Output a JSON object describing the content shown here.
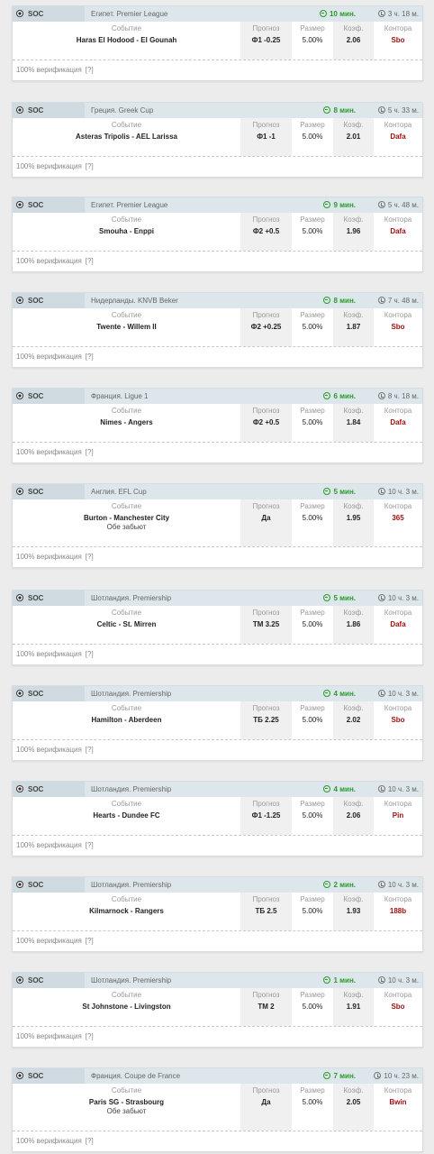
{
  "labels": {
    "sport": "SOC",
    "event": "Событие",
    "prediction": "Прогноз",
    "size": "Размер",
    "odds": "Коэф.",
    "bookmaker": "Контора",
    "verify": "100% верификация",
    "help": "[?]"
  },
  "tips": [
    {
      "league": "Египет. Premier League",
      "ago": "10 мин.",
      "left": "3 ч. 18 м.",
      "event": "Haras El Hodood - El Gounah",
      "sub": "",
      "prediction": "Ф1 -0.25",
      "size": "5.00%",
      "odds": "2.06",
      "bookmaker": "Sbo"
    },
    {
      "league": "Греция. Greek Cup",
      "ago": "8 мин.",
      "left": "5 ч. 33 м.",
      "event": "Asteras Tripolis - AEL Larissa",
      "sub": "",
      "prediction": "Ф1 -1",
      "size": "5.00%",
      "odds": "2.01",
      "bookmaker": "Dafa"
    },
    {
      "league": "Египет. Premier League",
      "ago": "9 мин.",
      "left": "5 ч. 48 м.",
      "event": "Smouha - Enppi",
      "sub": "",
      "prediction": "Ф2 +0.5",
      "size": "5.00%",
      "odds": "1.96",
      "bookmaker": "Dafa"
    },
    {
      "league": "Нидерланды. KNVB Beker",
      "ago": "8 мин.",
      "left": "7 ч. 48 м.",
      "event": "Twente - Willem II",
      "sub": "",
      "prediction": "Ф2 +0.25",
      "size": "5.00%",
      "odds": "1.87",
      "bookmaker": "Sbo"
    },
    {
      "league": "Франция. Ligue 1",
      "ago": "6 мин.",
      "left": "8 ч. 18 м.",
      "event": "Nimes - Angers",
      "sub": "",
      "prediction": "Ф2 +0.5",
      "size": "5.00%",
      "odds": "1.84",
      "bookmaker": "Dafa"
    },
    {
      "league": "Англия. EFL Cup",
      "ago": "5 мин.",
      "left": "10 ч. 3 м.",
      "event": "Burton - Manchester City",
      "sub": "Обе забьют",
      "prediction": "Да",
      "size": "5.00%",
      "odds": "1.95",
      "bookmaker": "365"
    },
    {
      "league": "Шотландия. Premiership",
      "ago": "5 мин.",
      "left": "10 ч. 3 м.",
      "event": "Celtic - St. Mirren",
      "sub": "",
      "prediction": "ТМ 3.25",
      "size": "5.00%",
      "odds": "1.86",
      "bookmaker": "Dafa"
    },
    {
      "league": "Шотландия. Premiership",
      "ago": "4 мин.",
      "left": "10 ч. 3 м.",
      "event": "Hamilton - Aberdeen",
      "sub": "",
      "prediction": "ТБ 2.25",
      "size": "5.00%",
      "odds": "2.02",
      "bookmaker": "Sbo"
    },
    {
      "league": "Шотландия. Premiership",
      "ago": "4 мин.",
      "left": "10 ч. 3 м.",
      "event": "Hearts - Dundee FC",
      "sub": "",
      "prediction": "Ф1 -1.25",
      "size": "5.00%",
      "odds": "2.06",
      "bookmaker": "Pin"
    },
    {
      "league": "Шотландия. Premiership",
      "ago": "2 мин.",
      "left": "10 ч. 3 м.",
      "event": "Kilmarnock - Rangers",
      "sub": "",
      "prediction": "ТБ 2.5",
      "size": "5.00%",
      "odds": "1.93",
      "bookmaker": "188b"
    },
    {
      "league": "Шотландия. Premiership",
      "ago": "1 мин.",
      "left": "10 ч. 3 м.",
      "event": "St Johnstone - Livingston",
      "sub": "",
      "prediction": "ТМ 2",
      "size": "5.00%",
      "odds": "1.91",
      "bookmaker": "Sbo"
    },
    {
      "league": "Франция. Coupe de France",
      "ago": "7 мин.",
      "left": "10 ч. 23 м.",
      "event": "Paris SG - Strasbourg",
      "sub": "Обе забьют",
      "prediction": "Да",
      "size": "5.00%",
      "odds": "2.05",
      "bookmaker": "Bwin"
    }
  ]
}
